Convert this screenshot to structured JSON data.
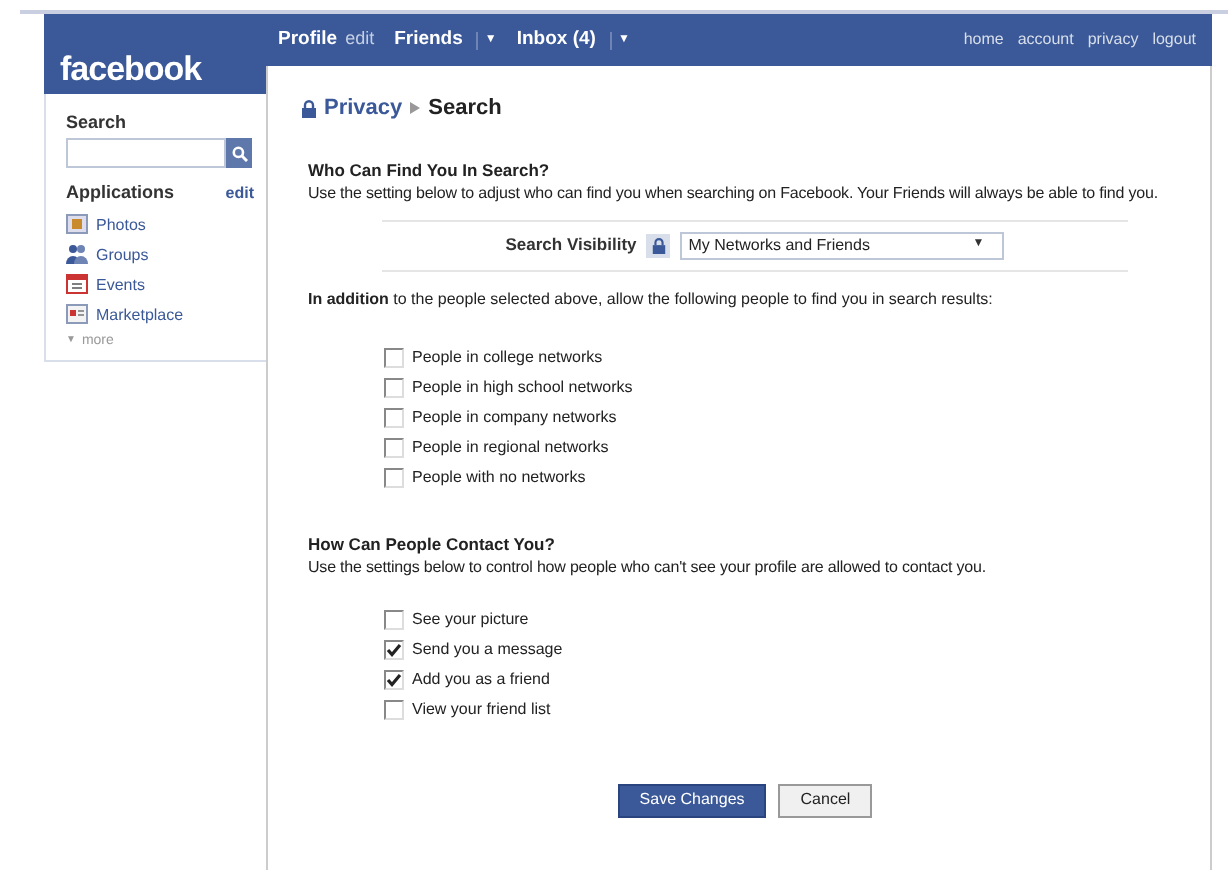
{
  "logo": "facebook",
  "nav": [
    {
      "label": "Profile",
      "kind": "main",
      "dropdown": false
    },
    {
      "label": "edit",
      "kind": "minor",
      "dropdown": false
    },
    {
      "label": "Friends",
      "kind": "main",
      "dropdown": true
    },
    {
      "label": "Inbox (4)",
      "kind": "main",
      "dropdown": true
    }
  ],
  "dropdown_glyph": "▼",
  "account_links": [
    "home",
    "account",
    "privacy",
    "logout"
  ],
  "sidebar": {
    "search_label": "Search",
    "applications_label": "Applications",
    "edit_link": "edit",
    "apps": [
      {
        "label": "Photos",
        "kind": "photos"
      },
      {
        "label": "Groups",
        "kind": "groups"
      },
      {
        "label": "Events",
        "kind": "events"
      },
      {
        "label": "Marketplace",
        "kind": "marketplace"
      }
    ],
    "more": "more"
  },
  "breadcrumb": {
    "parent": "Privacy",
    "current": "Search"
  },
  "search_section": {
    "heading": "Who Can Find You In Search?",
    "description": "Use the setting below to adjust who can find you when searching on Facebook. Your Friends will always be able to find you.",
    "visibility_label": "Search Visibility",
    "visibility_value": "My Networks and Friends",
    "addition_text": "**In addition** to the people selected above, allow the following people to find you in search results:",
    "options": [
      {
        "label": "People in college networks",
        "checked": false
      },
      {
        "label": "People in high school networks",
        "checked": false
      },
      {
        "label": "People in company networks",
        "checked": false
      },
      {
        "label": "People in regional networks",
        "checked": false
      },
      {
        "label": "People with no networks",
        "checked": false
      }
    ]
  },
  "contact_section": {
    "heading": "How Can People Contact You?",
    "description": "Use the settings below to control how people who can't see your profile are allowed to contact you.",
    "options": [
      {
        "label": "See your picture",
        "checked": false
      },
      {
        "label": "Send you a message",
        "checked": true
      },
      {
        "label": "Add you as a friend",
        "checked": true
      },
      {
        "label": "View your friend list",
        "checked": false
      }
    ]
  },
  "buttons": [
    {
      "label": "Save Changes",
      "kind": "primary"
    },
    {
      "label": "Cancel",
      "kind": "secondary"
    }
  ]
}
